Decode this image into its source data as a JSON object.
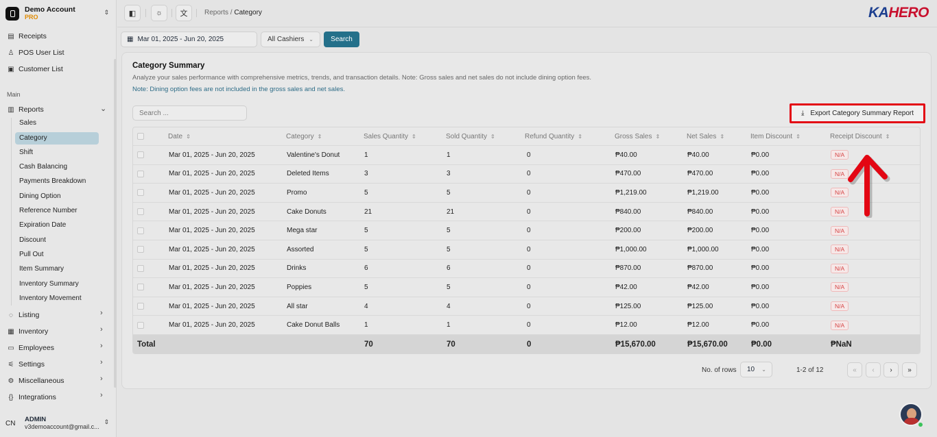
{
  "account": {
    "name": "Demo Account",
    "plan": "PRO"
  },
  "nav_top": [
    {
      "label": "Receipts",
      "icon": "receipt-icon"
    },
    {
      "label": "POS User List",
      "icon": "user-icon"
    },
    {
      "label": "Customer List",
      "icon": "contact-icon"
    }
  ],
  "section_label": "Main",
  "reports": {
    "label": "Reports",
    "sub_items": [
      "Sales",
      "Category",
      "Shift",
      "Cash Balancing",
      "Payments Breakdown",
      "Dining Option",
      "Reference Number",
      "Expiration Date",
      "Discount",
      "Pull Out",
      "Item Summary",
      "Inventory Summary",
      "Inventory Movement"
    ],
    "active": "Category"
  },
  "nav_bottom": [
    {
      "label": "Listing",
      "icon": "tag-icon"
    },
    {
      "label": "Inventory",
      "icon": "box-icon"
    },
    {
      "label": "Employees",
      "icon": "id-card-icon"
    },
    {
      "label": "Settings",
      "icon": "sliders-icon"
    },
    {
      "label": "Miscellaneous",
      "icon": "gear-icon"
    },
    {
      "label": "Integrations",
      "icon": "braces-icon"
    }
  ],
  "user": {
    "initials": "CN",
    "name": "ADMIN",
    "email": "v3demoaccount@gmail.c..."
  },
  "breadcrumb": {
    "parent": "Reports",
    "separator": "/",
    "current": "Category"
  },
  "brand": {
    "part1": "KA",
    "part2": "HERO"
  },
  "filters": {
    "date_range": "Mar 01, 2025 - Jun 20, 2025",
    "cashier": "All Cashiers",
    "search_label": "Search"
  },
  "panel": {
    "title": "Category Summary",
    "description": "Analyze your sales performance with comprehensive metrics, trends, and transaction details. Note: Gross sales and net sales do not include dining option fees.",
    "note": "Note: Dining option fees are not included in the gross sales and net sales.",
    "search_placeholder": "Search ...",
    "export_label": "Export Category Summary Report"
  },
  "table": {
    "columns": [
      "Date",
      "Category",
      "Sales Quantity",
      "Sold Quantity",
      "Refund Quantity",
      "Gross Sales",
      "Net Sales",
      "Item Discount",
      "Receipt Discount"
    ],
    "rows": [
      [
        "Mar 01, 2025 - Jun 20, 2025",
        "Valentine's Donut",
        "1",
        "1",
        "0",
        "₱40.00",
        "₱40.00",
        "₱0.00",
        "N/A"
      ],
      [
        "Mar 01, 2025 - Jun 20, 2025",
        "Deleted Items",
        "3",
        "3",
        "0",
        "₱470.00",
        "₱470.00",
        "₱0.00",
        "N/A"
      ],
      [
        "Mar 01, 2025 - Jun 20, 2025",
        "Promo",
        "5",
        "5",
        "0",
        "₱1,219.00",
        "₱1,219.00",
        "₱0.00",
        "N/A"
      ],
      [
        "Mar 01, 2025 - Jun 20, 2025",
        "Cake Donuts",
        "21",
        "21",
        "0",
        "₱840.00",
        "₱840.00",
        "₱0.00",
        "N/A"
      ],
      [
        "Mar 01, 2025 - Jun 20, 2025",
        "Mega star",
        "5",
        "5",
        "0",
        "₱200.00",
        "₱200.00",
        "₱0.00",
        "N/A"
      ],
      [
        "Mar 01, 2025 - Jun 20, 2025",
        "Assorted",
        "5",
        "5",
        "0",
        "₱1,000.00",
        "₱1,000.00",
        "₱0.00",
        "N/A"
      ],
      [
        "Mar 01, 2025 - Jun 20, 2025",
        "Drinks",
        "6",
        "6",
        "0",
        "₱870.00",
        "₱870.00",
        "₱0.00",
        "N/A"
      ],
      [
        "Mar 01, 2025 - Jun 20, 2025",
        "Poppies",
        "5",
        "5",
        "0",
        "₱42.00",
        "₱42.00",
        "₱0.00",
        "N/A"
      ],
      [
        "Mar 01, 2025 - Jun 20, 2025",
        "All star",
        "4",
        "4",
        "0",
        "₱125.00",
        "₱125.00",
        "₱0.00",
        "N/A"
      ],
      [
        "Mar 01, 2025 - Jun 20, 2025",
        "Cake Donut Balls",
        "1",
        "1",
        "0",
        "₱12.00",
        "₱12.00",
        "₱0.00",
        "N/A"
      ]
    ],
    "total": {
      "label": "Total",
      "sales_qty": "70",
      "sold_qty": "70",
      "refund_qty": "0",
      "gross": "₱15,670.00",
      "net": "₱15,670.00",
      "item_discount": "₱0.00",
      "receipt_discount": "₱NaN"
    }
  },
  "pagination": {
    "rows_label": "No. of rows",
    "rows_value": "10",
    "info": "1-2 of 12"
  },
  "colors": {
    "accent": "#24708a",
    "highlight": "#e30613",
    "active_nav": "#b7cfd9"
  }
}
